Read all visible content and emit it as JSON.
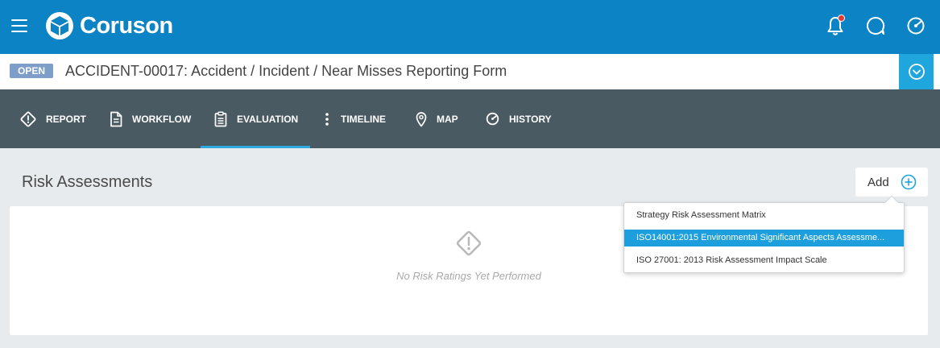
{
  "app": {
    "brand": "Coruson"
  },
  "record": {
    "status": "OPEN",
    "title": "ACCIDENT-00017: Accident / Incident / Near Misses Reporting Form"
  },
  "tabs": [
    {
      "label": "REPORT",
      "icon": "warning-diamond-icon"
    },
    {
      "label": "WORKFLOW",
      "icon": "document-icon"
    },
    {
      "label": "EVALUATION",
      "icon": "clipboard-icon",
      "active": true
    },
    {
      "label": "TIMELINE",
      "icon": "vertical-dots-icon"
    },
    {
      "label": "MAP",
      "icon": "map-pin-icon"
    },
    {
      "label": "HISTORY",
      "icon": "history-icon"
    }
  ],
  "section": {
    "title": "Risk Assessments",
    "add_label": "Add",
    "empty_message": "No Risk Ratings Yet Performed"
  },
  "dropdown": {
    "items": [
      {
        "label": "Strategy Risk Assessment Matrix"
      },
      {
        "label": "ISO14001:2015 Environmental Significant Aspects Assessme...",
        "selected": true
      },
      {
        "label": "ISO 27001: 2013 Risk Assessment Impact Scale"
      }
    ]
  },
  "colors": {
    "topbar": "#0b83c4",
    "tabbar": "#4a5a63",
    "accent": "#1ea6dd",
    "status_badge": "#7c9ec9",
    "notification": "#e53935"
  }
}
